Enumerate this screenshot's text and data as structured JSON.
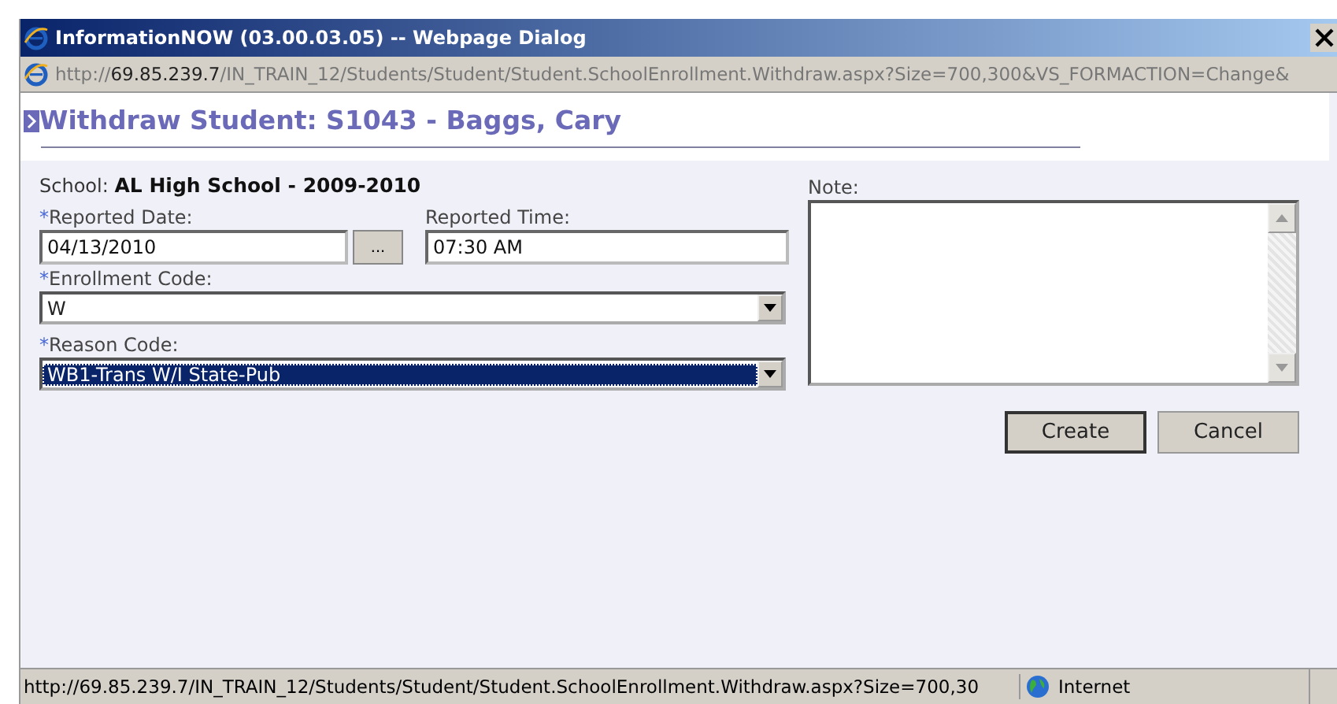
{
  "window": {
    "title": "InformationNOW (03.00.03.05) -- Webpage Dialog"
  },
  "address": {
    "scheme": "http://",
    "host": "69.85.239.7",
    "path": "/IN_TRAIN_12/Students/Student/Student.SchoolEnrollment.Withdraw.aspx?Size=700,300&VS_FORMACTION=Change&"
  },
  "heading": "Withdraw Student: S1043 - Baggs, Cary",
  "school": {
    "label": "School:",
    "value": "AL High School - 2009-2010"
  },
  "date": {
    "marker": "*",
    "label": "Reported Date:",
    "value": "04/13/2010",
    "button": "..."
  },
  "time": {
    "label": "Reported Time:",
    "value": "07:30 AM"
  },
  "selects": [
    {
      "marker": "*",
      "label": "Enrollment Code:",
      "value": "W",
      "selected": false
    },
    {
      "marker": "*",
      "label": "Reason Code:",
      "value": "WB1-Trans W/I State-Pub",
      "selected": true
    }
  ],
  "note": {
    "label": "Note:"
  },
  "buttons": [
    {
      "label": "Create",
      "default": true
    },
    {
      "label": "Cancel",
      "default": false
    }
  ],
  "status_bar": {
    "url": "http://69.85.239.7/IN_TRAIN_12/Students/Student/Student.SchoolEnrollment.Withdraw.aspx?Size=700,30",
    "zone": "Internet"
  }
}
